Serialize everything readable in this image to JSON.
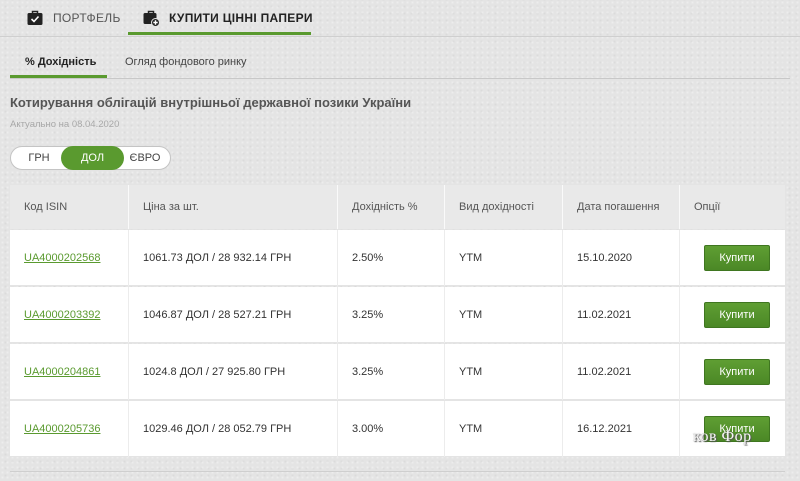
{
  "top_tabs": {
    "portfolio_label": "ПОРТФЕЛЬ",
    "buy_label": "КУПИТИ ЦІННІ ПАПЕРИ",
    "active": "buy",
    "accent_color": "#5a9a2f"
  },
  "sub_tabs": {
    "yield_label": "% Дохідність",
    "overview_label": "Огляд фондового ринку",
    "active": "yield"
  },
  "page": {
    "title": "Котирування облігацій внутрішньої державної позики України",
    "actual_date": "Актуально на 08.04.2020"
  },
  "currency_toggle": {
    "options": [
      "ГРН",
      "ДОЛ",
      "ЄВРО"
    ],
    "selected": "ДОЛ"
  },
  "table": {
    "headers": [
      "Код ISIN",
      "Ціна за шт.",
      "Дохідність %",
      "Вид дохідності",
      "Дата погашення",
      "Опції"
    ],
    "rows": [
      {
        "isin": "UA4000202568",
        "price": "1061.73 ДОЛ / 28 932.14 ГРН",
        "yield": "2.50%",
        "yield_type": "YTM",
        "maturity": "15.10.2020",
        "action": "Купити"
      },
      {
        "isin": "UA4000203392",
        "price": "1046.87 ДОЛ / 28 527.21 ГРН",
        "yield": "3.25%",
        "yield_type": "YTM",
        "maturity": "11.02.2021",
        "action": "Купити"
      },
      {
        "isin": "UA4000204861",
        "price": "1024.8 ДОЛ / 27 925.80 ГРН",
        "yield": "3.25%",
        "yield_type": "YTM",
        "maturity": "11.02.2021",
        "action": "Купити"
      },
      {
        "isin": "UA4000205736",
        "price": "1029.46 ДОЛ / 28 052.79 ГРН",
        "yield": "3.00%",
        "yield_type": "YTM",
        "maturity": "16.12.2021",
        "action": "Купити"
      }
    ]
  },
  "watermark": {
    "text": "ков Фор"
  },
  "icons": {
    "portfolio": "briefcase-check-icon",
    "buy": "briefcase-plus-icon"
  }
}
